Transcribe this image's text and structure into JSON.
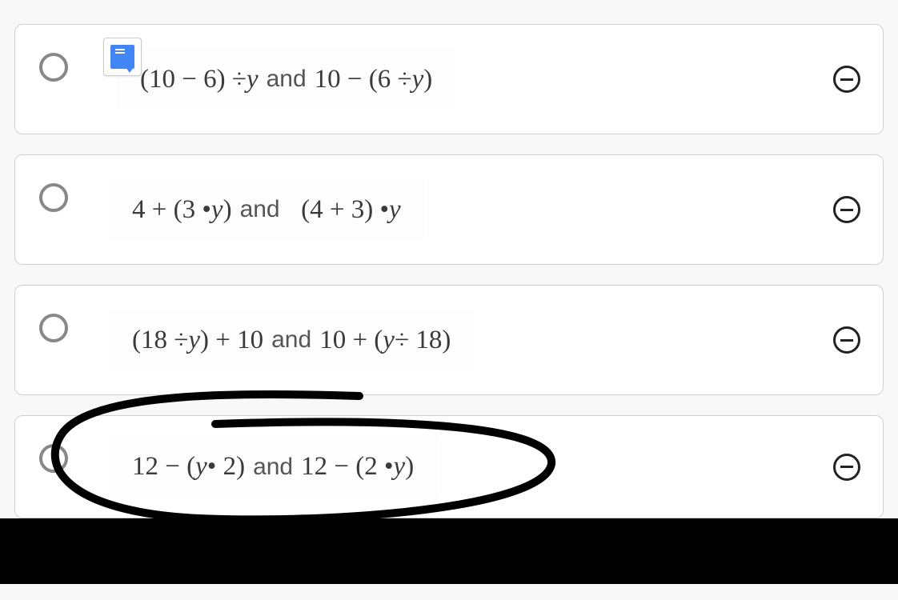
{
  "options": [
    {
      "expr_left": "(10 − 6) ÷ ",
      "var_left": "y",
      "mid": " and ",
      "expr_right_a": "10 − (6 ÷ ",
      "var_right": "y",
      "expr_right_b": ")",
      "has_translate": true
    },
    {
      "expr_left": "4 + (3 • ",
      "var_left": "y",
      "expr_left_b": ")",
      "mid": " and ",
      "spacer": "  ",
      "expr_right_a": "(4 + 3) • ",
      "var_right": "y",
      "expr_right_b": "",
      "has_translate": false
    },
    {
      "expr_left": "(18 ÷ ",
      "var_left": "y",
      "expr_left_b": ") + 10",
      "mid": " and ",
      "expr_right_a": "10 + (",
      "var_right": "y",
      "expr_right_b": " ÷ 18)",
      "has_translate": false
    },
    {
      "expr_left": "12 − (",
      "var_left": "y",
      "expr_left_b": " • 2)",
      "mid": " and ",
      "expr_right_a": "12 − (2 • ",
      "var_right": "y",
      "expr_right_b": ")",
      "has_translate": false,
      "circled": true
    }
  ]
}
